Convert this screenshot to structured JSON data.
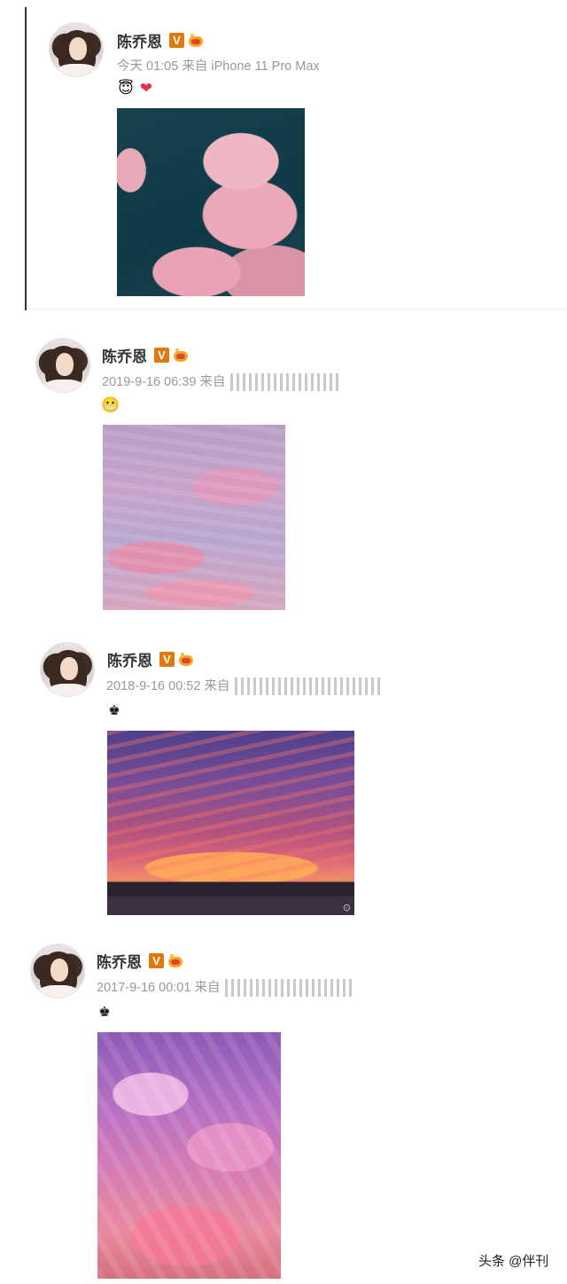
{
  "posts": [
    {
      "user_name": "陈乔恩",
      "verified_badge": "V",
      "timestamp": "今天 01:05",
      "source_prefix": "来自",
      "source": "iPhone 11 Pro Max",
      "emojis": [
        "smiling-face-with-halo",
        "heart"
      ],
      "image_subject": "pink clouds against dark teal sky"
    },
    {
      "user_name": "陈乔恩",
      "verified_badge": "V",
      "timestamp": "2019-9-16 06:39",
      "source_prefix": "来自",
      "source": "",
      "emojis": [
        "grimacing-face"
      ],
      "image_subject": "pink and lavender cloud layers"
    },
    {
      "user_name": "陈乔恩",
      "verified_badge": "V",
      "timestamp": "2018-9-16 00:52",
      "source_prefix": "来自",
      "source": "",
      "emojis": [
        "emoji-figure"
      ],
      "image_subject": "purple sunset over road"
    },
    {
      "user_name": "陈乔恩",
      "verified_badge": "V",
      "timestamp": "2017-9-16 00:01",
      "source_prefix": "来自",
      "source": "",
      "emojis": [
        "emoji-figure"
      ],
      "image_subject": "purple and pink sunlit clouds"
    }
  ],
  "footer": {
    "brand": "头条 @伴刊"
  },
  "colors": {
    "name_text": "#333333",
    "meta_text": "#999999",
    "verified_badge": "#e2770f"
  }
}
